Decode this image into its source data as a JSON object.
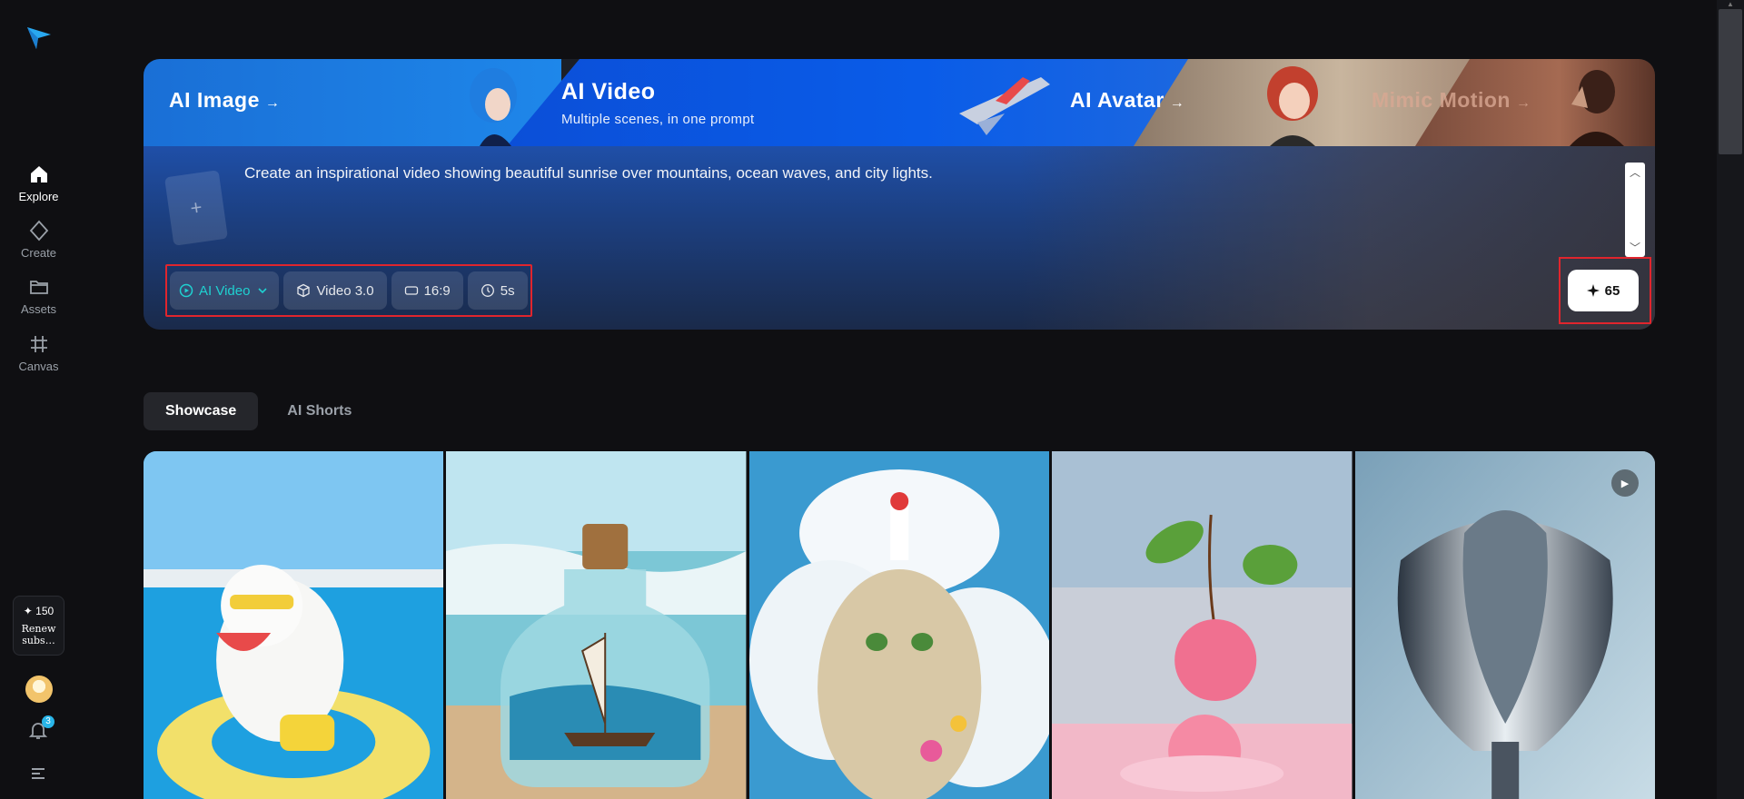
{
  "sidebar": {
    "items": [
      {
        "label": "Explore",
        "icon": "home-icon",
        "active": true
      },
      {
        "label": "Create",
        "icon": "diamond-icon"
      },
      {
        "label": "Assets",
        "icon": "folder-icon"
      },
      {
        "label": "Canvas",
        "icon": "frame-icon"
      }
    ],
    "credits": {
      "amount": "✦ 150",
      "renew": "Renew subs…"
    },
    "notifications": "3"
  },
  "hero": {
    "tabs": [
      {
        "label": "AI Image",
        "arrow": "→"
      },
      {
        "label": "AI Video",
        "subtitle": "Multiple scenes, in one prompt"
      },
      {
        "label": "AI Avatar",
        "arrow": "→"
      },
      {
        "label": "Mimic Motion",
        "arrow": "→"
      }
    ],
    "upload_symbol": "+",
    "prompt": "Create an inspirational video showing beautiful sunrise over mountains, ocean waves, and city lights.",
    "toolbar": {
      "mode": "AI Video",
      "model": "Video 3.0",
      "ratio": "16:9",
      "duration": "5s"
    },
    "generate": {
      "cost": "65"
    }
  },
  "showcase": {
    "tabs": [
      "Showcase",
      "AI Shorts"
    ]
  },
  "colors": {
    "accent": "#1fd1d1",
    "highlight": "#e0252d",
    "background": "#0f0f12"
  }
}
